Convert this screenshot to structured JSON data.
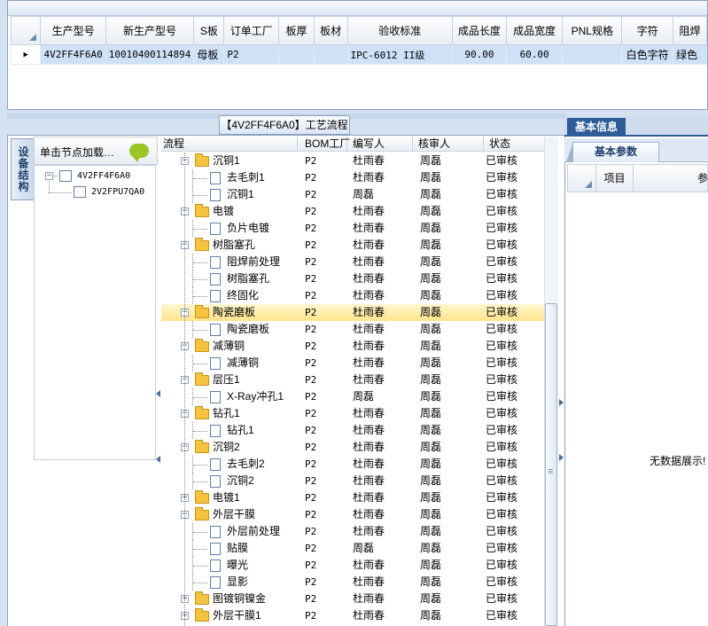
{
  "top_grid": {
    "columns": [
      "生产型号",
      "新生产型号",
      "S板",
      "订单工厂",
      "板厚",
      "板材",
      "验收标准",
      "成品长度",
      "成品宽度",
      "PNL规格",
      "字符",
      "阻焊"
    ],
    "row": [
      "4V2FF4F6A0",
      "10010400114894",
      "母板",
      "P2",
      "",
      "",
      "IPC-6012 II级",
      "90.00",
      "60.00",
      "",
      "白色字符",
      "绿色"
    ],
    "row_indicator": "▶"
  },
  "process": {
    "title": "【4V2FF4F6A0】工艺流程",
    "columns": [
      "流程",
      "BOM工厂",
      "编写人",
      "核审人",
      "状态"
    ],
    "rows": [
      {
        "name": "沉铜1",
        "bom": "P2",
        "writer": "杜雨春",
        "reviewer": "周磊",
        "status": "已审核",
        "level": 0
      },
      {
        "name": "去毛刺1",
        "bom": "P2",
        "writer": "杜雨春",
        "reviewer": "周磊",
        "status": "已审核",
        "level": 1
      },
      {
        "name": "沉铜1",
        "bom": "P2",
        "writer": "周磊",
        "reviewer": "周磊",
        "status": "已审核",
        "level": 1
      },
      {
        "name": "电镀",
        "bom": "P2",
        "writer": "杜雨春",
        "reviewer": "周磊",
        "status": "已审核",
        "level": 0
      },
      {
        "name": "负片电镀",
        "bom": "P2",
        "writer": "杜雨春",
        "reviewer": "周磊",
        "status": "已审核",
        "level": 1
      },
      {
        "name": "树脂塞孔",
        "bom": "P2",
        "writer": "杜雨春",
        "reviewer": "周磊",
        "status": "已审核",
        "level": 0
      },
      {
        "name": "阻焊前处理",
        "bom": "P2",
        "writer": "杜雨春",
        "reviewer": "周磊",
        "status": "已审核",
        "level": 1
      },
      {
        "name": "树脂塞孔",
        "bom": "P2",
        "writer": "杜雨春",
        "reviewer": "周磊",
        "status": "已审核",
        "level": 1
      },
      {
        "name": "终固化",
        "bom": "P2",
        "writer": "杜雨春",
        "reviewer": "周磊",
        "status": "已审核",
        "level": 1
      },
      {
        "name": "陶瓷磨板",
        "bom": "P2",
        "writer": "杜雨春",
        "reviewer": "周磊",
        "status": "已审核",
        "level": 0,
        "selected": true
      },
      {
        "name": "陶瓷磨板",
        "bom": "P2",
        "writer": "杜雨春",
        "reviewer": "周磊",
        "status": "已审核",
        "level": 1
      },
      {
        "name": "减薄铜",
        "bom": "P2",
        "writer": "杜雨春",
        "reviewer": "周磊",
        "status": "已审核",
        "level": 0
      },
      {
        "name": "减薄铜",
        "bom": "P2",
        "writer": "杜雨春",
        "reviewer": "周磊",
        "status": "已审核",
        "level": 1
      },
      {
        "name": "层压1",
        "bom": "P2",
        "writer": "杜雨春",
        "reviewer": "周磊",
        "status": "已审核",
        "level": 0
      },
      {
        "name": "X-Ray冲孔1",
        "bom": "P2",
        "writer": "周磊",
        "reviewer": "周磊",
        "status": "已审核",
        "level": 1
      },
      {
        "name": "钻孔1",
        "bom": "P2",
        "writer": "杜雨春",
        "reviewer": "周磊",
        "status": "已审核",
        "level": 0
      },
      {
        "name": "钻孔1",
        "bom": "P2",
        "writer": "杜雨春",
        "reviewer": "周磊",
        "status": "已审核",
        "level": 1
      },
      {
        "name": "沉铜2",
        "bom": "P2",
        "writer": "杜雨春",
        "reviewer": "周磊",
        "status": "已审核",
        "level": 0
      },
      {
        "name": "去毛刺2",
        "bom": "P2",
        "writer": "杜雨春",
        "reviewer": "周磊",
        "status": "已审核",
        "level": 1
      },
      {
        "name": "沉铜2",
        "bom": "P2",
        "writer": "杜雨春",
        "reviewer": "周磊",
        "status": "已审核",
        "level": 1
      },
      {
        "name": "电镀1",
        "bom": "P2",
        "writer": "杜雨春",
        "reviewer": "周磊",
        "status": "已审核",
        "level": 0,
        "collapsed": true
      },
      {
        "name": "外层干膜",
        "bom": "P2",
        "writer": "杜雨春",
        "reviewer": "周磊",
        "status": "已审核",
        "level": 0
      },
      {
        "name": "外层前处理",
        "bom": "P2",
        "writer": "杜雨春",
        "reviewer": "周磊",
        "status": "已审核",
        "level": 1
      },
      {
        "name": "贴膜",
        "bom": "P2",
        "writer": "周磊",
        "reviewer": "周磊",
        "status": "已审核",
        "level": 1
      },
      {
        "name": "曝光",
        "bom": "P2",
        "writer": "杜雨春",
        "reviewer": "周磊",
        "status": "已审核",
        "level": 1
      },
      {
        "name": "显影",
        "bom": "P2",
        "writer": "杜雨春",
        "reviewer": "周磊",
        "status": "已审核",
        "level": 1
      },
      {
        "name": "图镀铜镍金",
        "bom": "P2",
        "writer": "杜雨春",
        "reviewer": "周磊",
        "status": "已审核",
        "level": 0,
        "collapsed": true
      },
      {
        "name": "外层干膜1",
        "bom": "P2",
        "writer": "杜雨春",
        "reviewer": "周磊",
        "status": "已审核",
        "level": 0,
        "collapsed": true
      }
    ]
  },
  "structure": {
    "vertical_tab": "设备结构",
    "header": "单击节点加载…",
    "nodes": [
      {
        "label": "4V2FF4F6A0",
        "level": 0,
        "expander": "−"
      },
      {
        "label": "2V2FPU7QA0",
        "level": 1
      }
    ]
  },
  "right": {
    "tab": "基本信息",
    "subtab": "基本参数",
    "col_item": "项目",
    "col_param": "参数",
    "empty_text": "无数据展示!"
  }
}
